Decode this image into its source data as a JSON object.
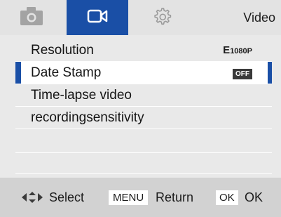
{
  "header": {
    "title": "Video",
    "tabs": [
      {
        "name": "photo",
        "icon": "camera-icon",
        "active": false
      },
      {
        "name": "video",
        "icon": "video-camera-icon",
        "active": true
      },
      {
        "name": "settings",
        "icon": "gear-icon",
        "active": false
      }
    ]
  },
  "menu": {
    "items": [
      {
        "label": "Resolution",
        "value_top": "E",
        "value_main": "1080P"
      },
      {
        "label": "Date Stamp",
        "value": "OFF",
        "selected": true
      },
      {
        "label": "Time-lapse video"
      },
      {
        "label": "recordingsensitivity"
      }
    ]
  },
  "footer": {
    "select_label": "Select",
    "menu_key": "MENU",
    "return_label": "Return",
    "ok_key": "OK",
    "ok_label": "OK"
  },
  "colors": {
    "accent": "#1a4fa6",
    "background": "#e9e9e9",
    "footer": "#d2d2d2"
  }
}
